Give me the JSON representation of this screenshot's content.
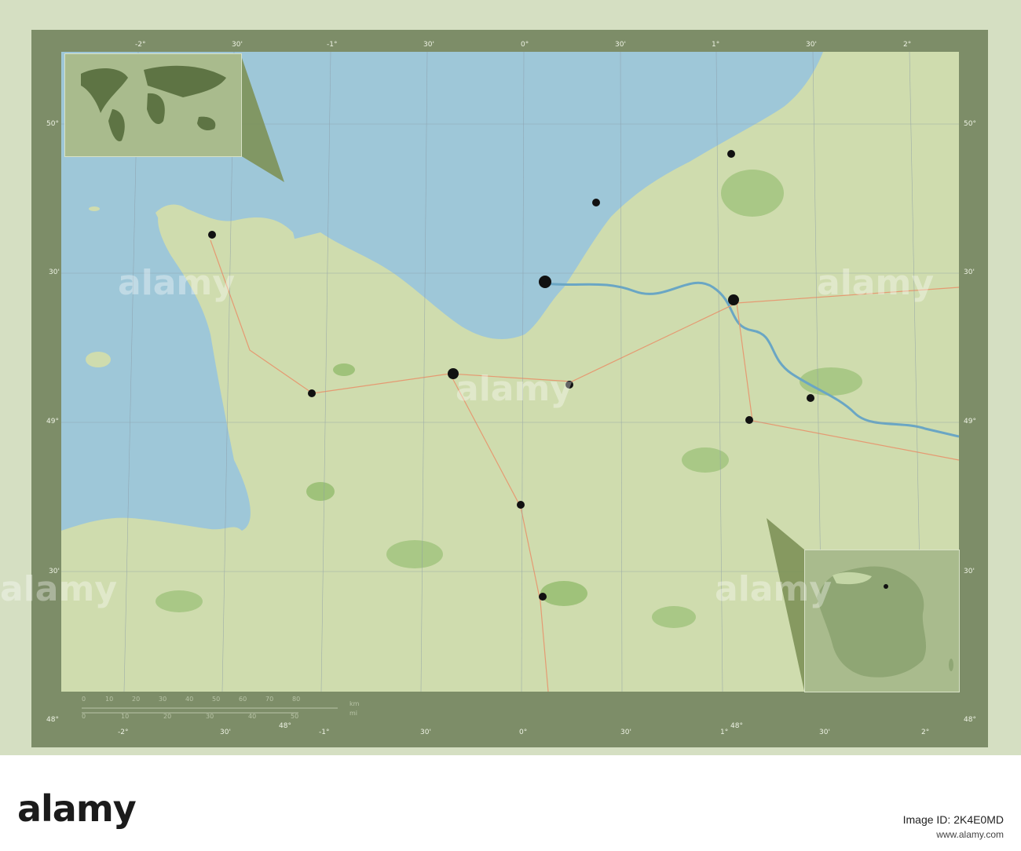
{
  "map": {
    "top_lon_labels": [
      "-2°",
      "30'",
      "-1°",
      "30'",
      "0°",
      "30'",
      "1°",
      "30'",
      "2°"
    ],
    "bottom_lon_labels": [
      "-2°",
      "30'",
      "-1°",
      "30'",
      "0°",
      "30'",
      "1°",
      "30'",
      "2°"
    ],
    "left_lat_labels": [
      "50°",
      "30'",
      "49°",
      "30'",
      "48°"
    ],
    "right_lat_labels": [
      "50°",
      "30'",
      "49°",
      "30'",
      "48°"
    ],
    "bottom_extra_labels": [
      "48°",
      "48°"
    ],
    "scale": {
      "km_label": "km",
      "mi_label": "mi",
      "km_ticks": [
        "0",
        "10",
        "20",
        "30",
        "40",
        "50",
        "60",
        "70",
        "80"
      ],
      "mi_ticks": [
        "0",
        "10",
        "20",
        "30",
        "40",
        "50"
      ]
    },
    "colors": {
      "sea": "#9ec7d8",
      "land": "#cfdcae",
      "frame": "#7d8d68",
      "forest": "#9fc27a"
    }
  },
  "watermark": {
    "logo": "alamy",
    "image_id_line": "Image ID: 2K4E0MD",
    "url_line": "www.alamy.com",
    "mid_logo": "alamy"
  }
}
